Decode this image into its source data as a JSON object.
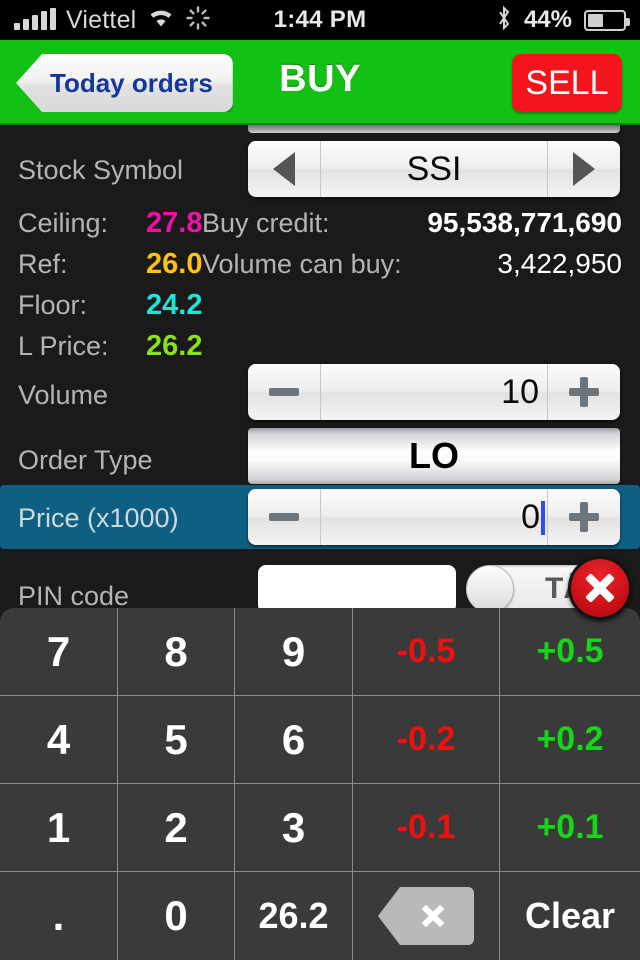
{
  "status_bar": {
    "signal_icon": "signal-bars-icon",
    "carrier": "Viettel",
    "wifi_icon": "wifi-icon",
    "activity_icon": "activity-spinner-icon",
    "time": "1:44 PM",
    "bluetooth_icon": "bluetooth-icon",
    "battery_percent": "44%",
    "battery_icon": "battery-icon"
  },
  "navbar": {
    "back_label": "Today orders",
    "back_icon": "chevron-left-icon",
    "title": "BUY",
    "sell_label": "SELL",
    "green": "#12c113",
    "red": "#f4141b"
  },
  "form": {
    "stock_symbol": {
      "label": "Stock Symbol",
      "value": "SSI",
      "prev_icon": "triangle-left-icon",
      "next_icon": "triangle-right-icon"
    },
    "stats": [
      {
        "key": "Ceiling:",
        "value": "27.8",
        "color": "#f010a8"
      },
      {
        "key": "Ref:",
        "value": "26.0",
        "color": "#ffc211"
      },
      {
        "key": "Floor:",
        "value": "24.2",
        "color": "#19e8d8"
      },
      {
        "key": "L Price:",
        "value": "26.2",
        "color": "#8ae019"
      }
    ],
    "credits": [
      {
        "key": "Buy credit:",
        "value": "95,538,771,690",
        "bold": true
      },
      {
        "key": "Volume can buy:",
        "value": "3,422,950",
        "bold": false
      }
    ],
    "volume": {
      "label": "Volume",
      "value": "10",
      "minus_icon": "minus-icon",
      "plus_icon": "plus-icon"
    },
    "order_type": {
      "label": "Order Type",
      "value": "LO"
    },
    "price": {
      "label": "Price (x1000)",
      "value": "0",
      "minus_icon": "minus-icon",
      "plus_icon": "plus-icon",
      "highlight_color": "#0f5f82",
      "caret_color": "#2b4ff0"
    },
    "pin": {
      "label": "PIN code",
      "value": "",
      "toggle_label": "TẮ",
      "toggle_state": "off"
    }
  },
  "close_keypad": {
    "icon": "close-x-icon"
  },
  "keypad": {
    "rows": [
      [
        {
          "label": "7",
          "kind": "digit"
        },
        {
          "label": "8",
          "kind": "digit"
        },
        {
          "label": "9",
          "kind": "digit"
        },
        {
          "label": "-0.5",
          "kind": "neg"
        },
        {
          "label": "+0.5",
          "kind": "pos"
        }
      ],
      [
        {
          "label": "4",
          "kind": "digit"
        },
        {
          "label": "5",
          "kind": "digit"
        },
        {
          "label": "6",
          "kind": "digit"
        },
        {
          "label": "-0.2",
          "kind": "neg"
        },
        {
          "label": "+0.2",
          "kind": "pos"
        }
      ],
      [
        {
          "label": "1",
          "kind": "digit"
        },
        {
          "label": "2",
          "kind": "digit"
        },
        {
          "label": "3",
          "kind": "digit"
        },
        {
          "label": "-0.1",
          "kind": "neg"
        },
        {
          "label": "+0.1",
          "kind": "pos"
        }
      ],
      [
        {
          "label": ".",
          "kind": "digit"
        },
        {
          "label": "0",
          "kind": "digit"
        },
        {
          "label": "26.2",
          "kind": "small"
        },
        {
          "label": "",
          "kind": "backspace"
        },
        {
          "label": "Clear",
          "kind": "clear"
        }
      ]
    ]
  }
}
